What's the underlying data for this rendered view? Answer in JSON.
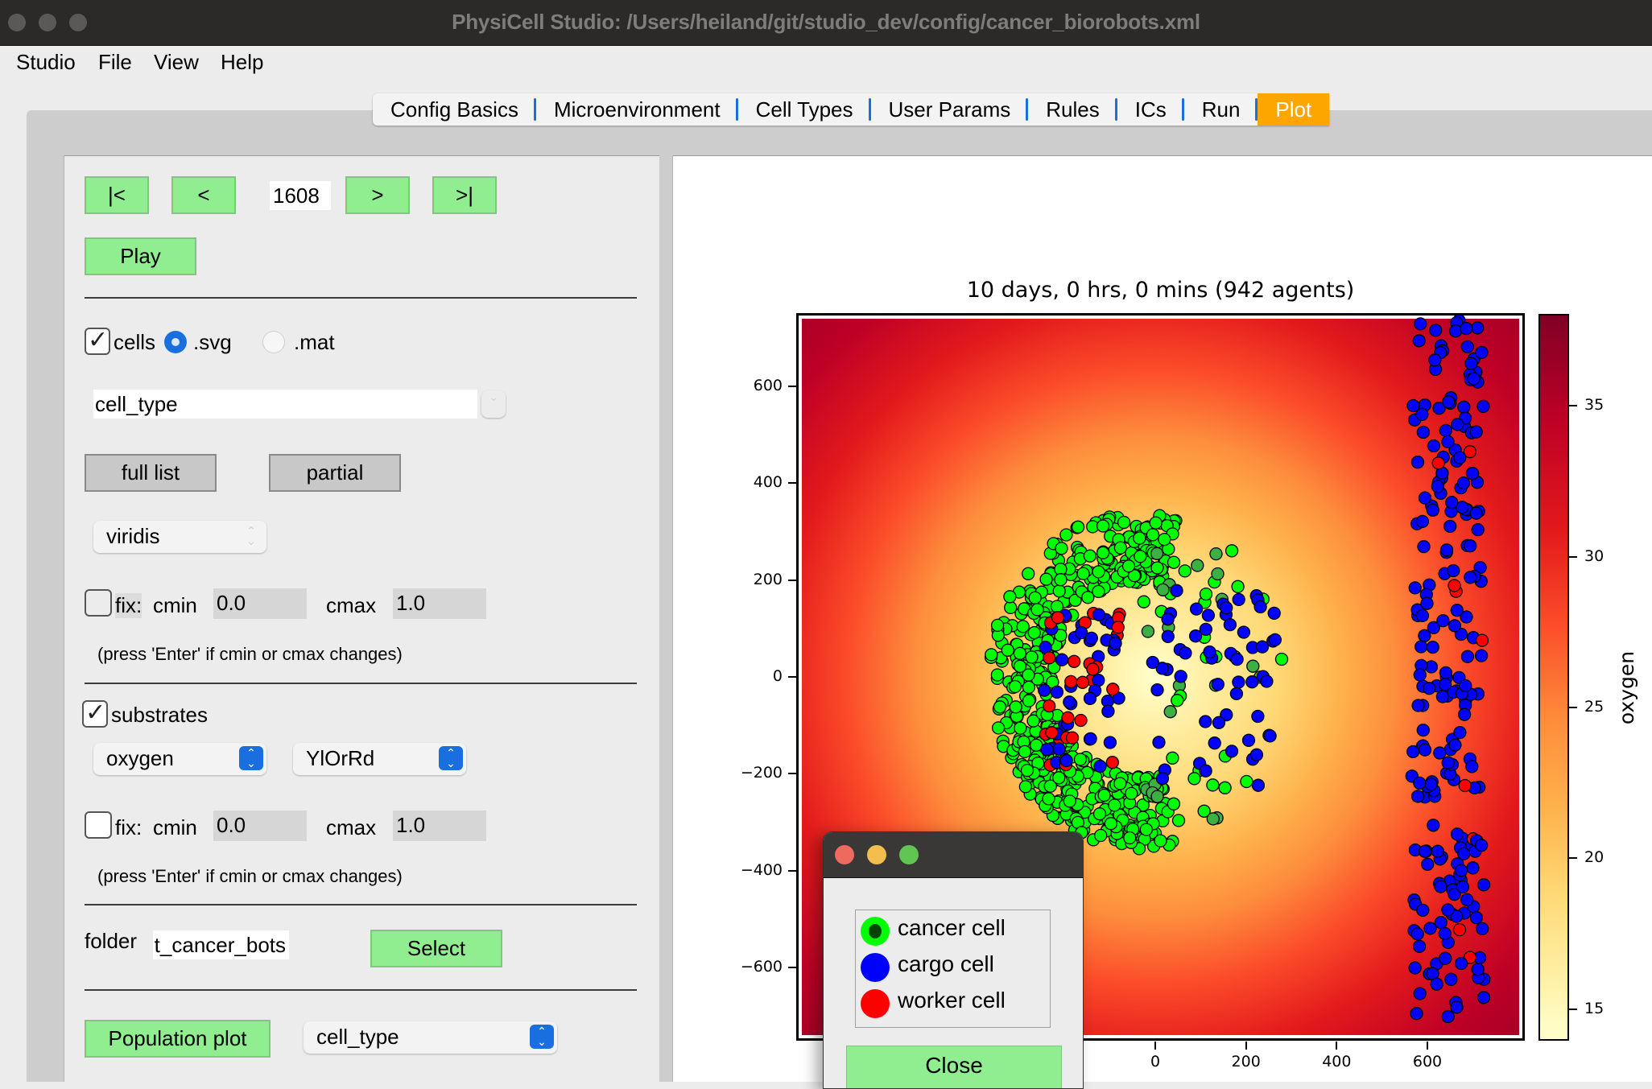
{
  "window": {
    "title": "PhysiCell Studio: /Users/heiland/git/studio_dev/config/cancer_biorobots.xml"
  },
  "menu": [
    "Studio",
    "File",
    "View",
    "Help"
  ],
  "tabs": [
    {
      "label": "Config Basics",
      "active": false
    },
    {
      "label": "Microenvironment",
      "active": false
    },
    {
      "label": "Cell Types",
      "active": false
    },
    {
      "label": "User Params",
      "active": false
    },
    {
      "label": "Rules",
      "active": false
    },
    {
      "label": "ICs",
      "active": false
    },
    {
      "label": "Run",
      "active": false
    },
    {
      "label": "Plot",
      "active": true
    }
  ],
  "colors": {
    "accent_tab": "#ffa500",
    "green_button": "#90ee90",
    "select_blue": "#1a6fe0"
  },
  "controls": {
    "first_label": "|<",
    "prev_label": "<",
    "frame_value": "1608",
    "next_label": ">",
    "last_label": ">|",
    "play_label": "Play",
    "cells_checkbox_label": "cells",
    "cells_checked": true,
    "svg_radio_label": ".svg",
    "mat_radio_label": ".mat",
    "cell_scalar_value": "cell_type",
    "full_list_label": "full list",
    "partial_label": "partial",
    "cell_colormap_value": "viridis",
    "cell_fix_label": "fix:",
    "cell_cmin_label": "cmin",
    "cell_cmin_value": "0.0",
    "cell_cmax_label": "cmax",
    "cell_cmax_value": "1.0",
    "cell_hint": "(press 'Enter' if cmin or cmax changes)",
    "substrates_checkbox_label": "substrates",
    "substrates_checked": true,
    "substrate_value": "oxygen",
    "substrate_colormap_value": "YlOrRd",
    "sub_fix_label": "fix:",
    "sub_cmin_label": "cmin",
    "sub_cmin_value": "0.0",
    "sub_cmax_label": "cmax",
    "sub_cmax_value": "1.0",
    "sub_hint": "(press 'Enter' if cmin or cmax changes)",
    "folder_label": "folder",
    "folder_value": "output_cancer_bots",
    "select_label": "Select",
    "population_plot_label": "Population plot",
    "population_value": "cell_type"
  },
  "plot": {
    "title": "10 days, 0 hrs, 0 mins (942 agents)",
    "x_ticks": [
      "0",
      "200",
      "400",
      "600"
    ],
    "y_ticks": [
      "600",
      "400",
      "200",
      "0",
      "−200",
      "−400",
      "−600"
    ],
    "colorbar_label": "oxygen",
    "colorbar_ticks": [
      "35",
      "30",
      "25",
      "20",
      "15"
    ],
    "colormap": "YlOrRd"
  },
  "chart_data": {
    "type": "scatter",
    "title": "10 days, 0 hrs, 0 mins (942 agents)",
    "xlabel": "",
    "ylabel": "",
    "xlim": [
      -790,
      810
    ],
    "ylim": [
      -750,
      750
    ],
    "x_ticks": [
      0,
      200,
      400,
      600
    ],
    "y_ticks": [
      -600,
      -400,
      -200,
      0,
      200,
      400,
      600
    ],
    "background_field": {
      "name": "oxygen",
      "colormap": "YlOrRd",
      "range": [
        14,
        38
      ],
      "colorbar_ticks": [
        15,
        20,
        25,
        30,
        35
      ],
      "min_center": [
        0,
        0
      ]
    },
    "series": [
      {
        "name": "cancer cell",
        "color": "#00ff00",
        "region": "crescent cluster",
        "center": [
          -10,
          0
        ],
        "approx_radius_outer": 330
      },
      {
        "name": "cargo cell",
        "color": "#0000ff",
        "region": "right edge band and scattered in tumor",
        "x_range": [
          540,
          720
        ]
      },
      {
        "name": "worker cell",
        "color": "#ff0000",
        "region": "inside tumor, few at right edge"
      }
    ],
    "agent_count": 942,
    "legend": [
      "cancer cell",
      "cargo cell",
      "worker cell"
    ]
  },
  "legend_popup": {
    "items": [
      {
        "label": "cancer cell",
        "color": "#00ff00",
        "inner": "#004400"
      },
      {
        "label": "cargo cell",
        "color": "#0000ff"
      },
      {
        "label": "worker cell",
        "color": "#ff0000"
      }
    ],
    "close_label": "Close"
  }
}
